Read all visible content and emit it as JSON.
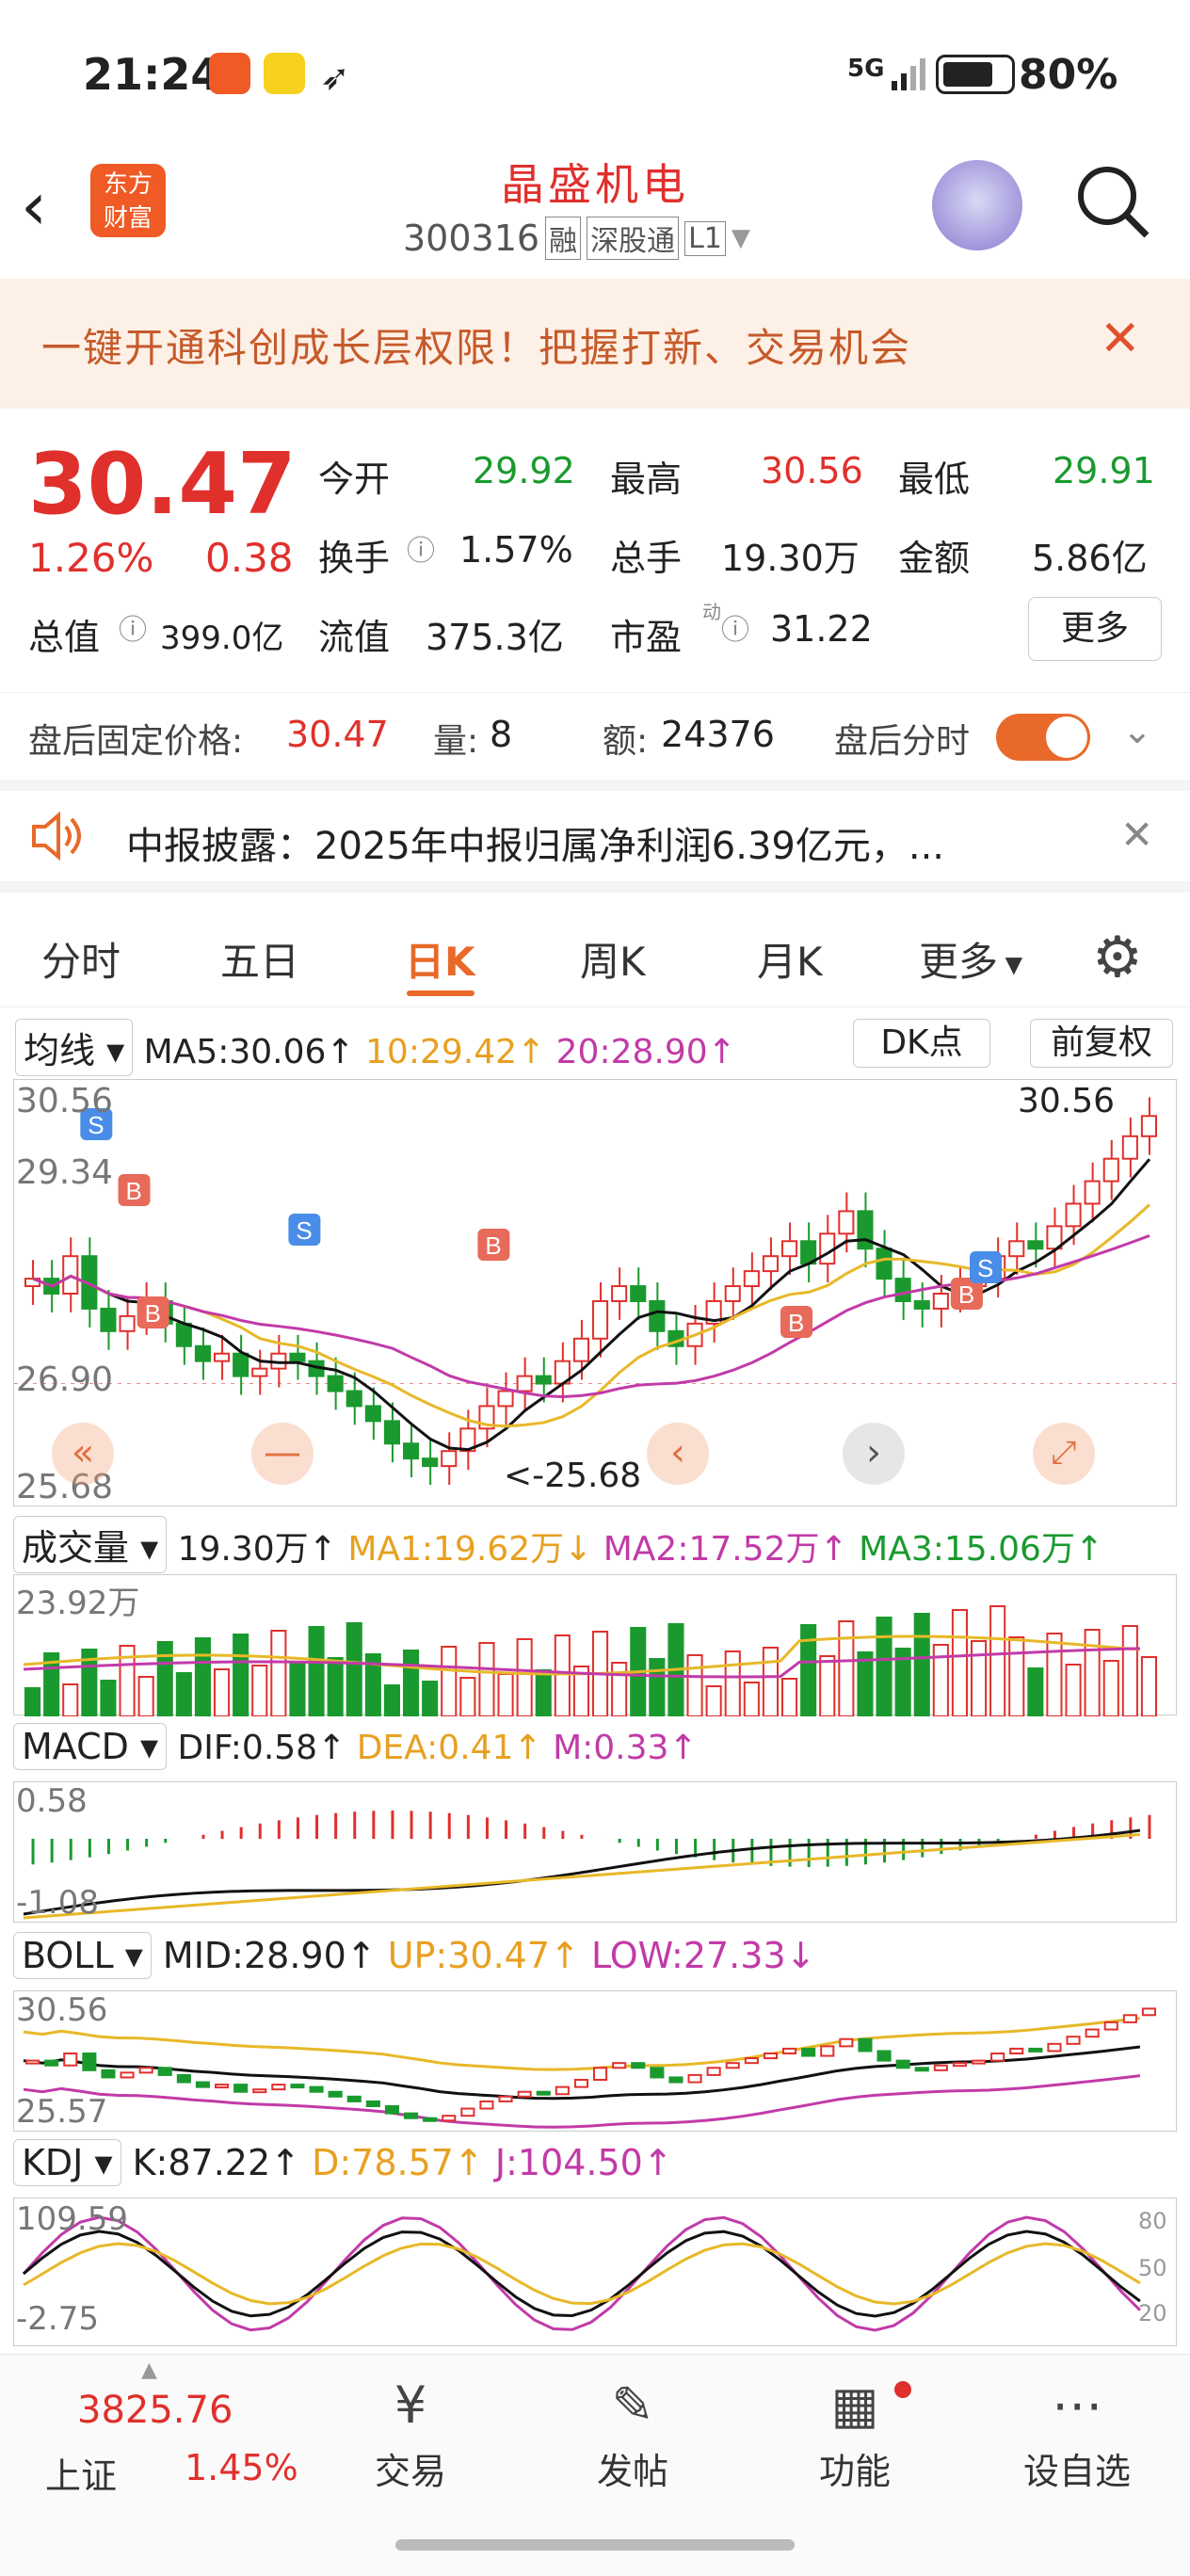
{
  "status": {
    "time": "21:24",
    "network": "5G",
    "battery": "80%"
  },
  "header": {
    "brand": "东方\n财富",
    "name": "晶盛机电",
    "code": "300316",
    "tags": [
      "融",
      "深股通",
      "L1"
    ]
  },
  "banner": {
    "text": "一键开通科创成长层权限！把握打新、交易机会"
  },
  "quote": {
    "price": "30.47",
    "pct": "1.26%",
    "chg": "0.38",
    "open_l": "今开",
    "open": "29.92",
    "high_l": "最高",
    "high": "30.56",
    "low_l": "最低",
    "low": "29.91",
    "turn_l": "换手",
    "turn": "1.57%",
    "vol_l": "总手",
    "vol": "19.30万",
    "amt_l": "金额",
    "amt": "5.86亿",
    "mcap_l": "总值",
    "mcap": "399.0亿",
    "fcap_l": "流值",
    "fcap": "375.3亿",
    "pe_l": "市盈",
    "pe_sup": "动",
    "pe": "31.22",
    "more": "更多"
  },
  "after": {
    "fixed_l": "盘后固定价格:",
    "fixed": "30.47",
    "qty_l": "量:",
    "qty": "8",
    "amt_l": "额:",
    "amt": "24376",
    "split_l": "盘后分时"
  },
  "notice": {
    "text": "中报披露：2025年中报归属净利润6.39亿元，..."
  },
  "tabs": [
    "分时",
    "五日",
    "日K",
    "周K",
    "月K",
    "更多"
  ],
  "kline": {
    "sel": "均线",
    "ma5": "MA5:30.06",
    "ma10": "10:29.42",
    "ma20": "20:28.90",
    "dk": "DK点",
    "adj": "前复权",
    "ymax": "30.56",
    "y2": "29.34",
    "y3": "26.90",
    "ymin": "25.68",
    "hi_tag": "30.56",
    "lo_tag": "<-25.68",
    "marks": {
      "s": "S",
      "b": "B"
    }
  },
  "volume": {
    "sel": "成交量",
    "v": "19.30万",
    "ma1": "MA1:19.62万",
    "ma2": "MA2:17.52万",
    "ma3": "MA3:15.06万",
    "ymax": "23.92万"
  },
  "macd": {
    "sel": "MACD",
    "dif": "DIF:0.58",
    "dea": "DEA:0.41",
    "m": "M:0.33",
    "ymax": "0.58",
    "ymin": "-1.08"
  },
  "boll": {
    "sel": "BOLL",
    "mid": "MID:28.90",
    "up": "UP:30.47",
    "low": "LOW:27.33",
    "ymax": "30.56",
    "ymin": "25.57"
  },
  "kdj": {
    "sel": "KDJ",
    "k": "K:87.22",
    "d": "D:78.57",
    "j": "J:104.50",
    "ymax": "109.59",
    "ymin": "-2.75",
    "r80": "80",
    "r50": "50",
    "r20": "20"
  },
  "bottom": {
    "index_val": "3825.76",
    "index_name": "上证",
    "index_pct": "1.45%",
    "trade": "交易",
    "post": "发帖",
    "func": "功能",
    "watch": "设自选"
  },
  "colors": {
    "up": "#e0302c",
    "down": "#1a9a2e",
    "ma10": "#e8b828",
    "ma20": "#c23aa8",
    "accent": "#e8692a"
  }
}
